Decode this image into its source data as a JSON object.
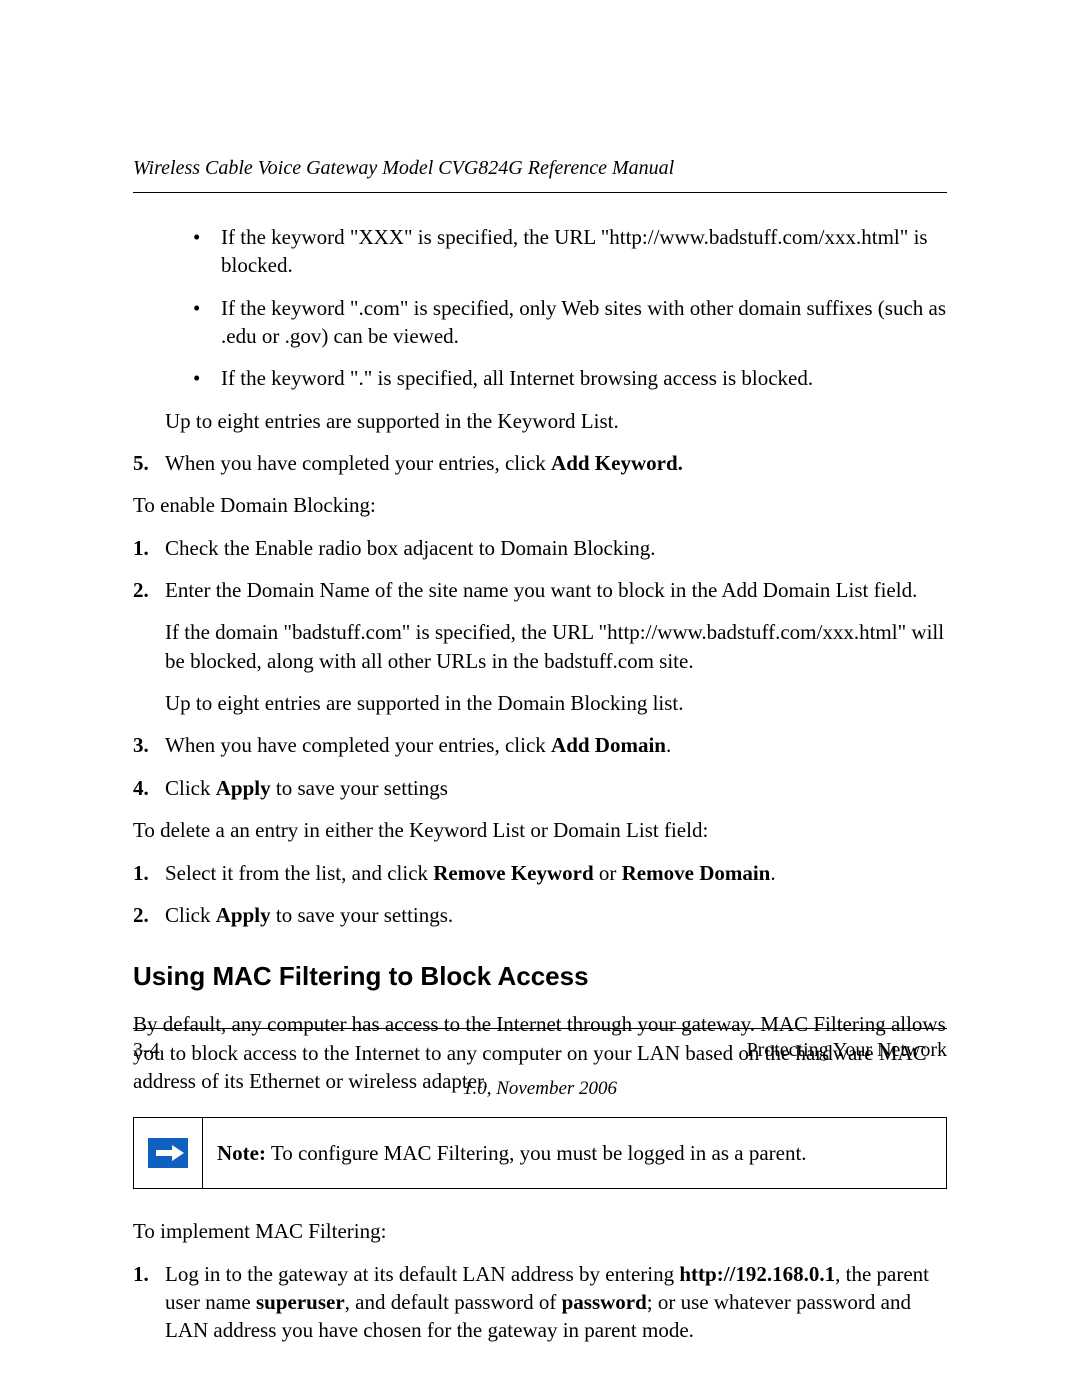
{
  "header": {
    "running_title": "Wireless Cable Voice Gateway Model CVG824G Reference Manual"
  },
  "bullets": {
    "b1a": "If the keyword \"XXX\" is specified, the URL \"http://www.badstuff.com/xxx.html\" is blocked.",
    "b1b": "If the keyword \".com\" is specified, only Web sites with other domain suffixes (such as .edu or .gov) can be viewed.",
    "b1c": "If the keyword \".\" is specified, all Internet browsing access is blocked.",
    "after": "Up to eight entries are supported in the Keyword List."
  },
  "step5": {
    "num": "5.",
    "pre": "When you have completed your entries, click ",
    "bold": "Add Keyword."
  },
  "domain_intro": "To enable Domain Blocking:",
  "d1": {
    "num": "1.",
    "text": "Check the Enable radio box adjacent to Domain Blocking."
  },
  "d2": {
    "num": "2.",
    "text": "Enter the Domain Name of the site name you want to block in the Add Domain List field.",
    "sub1": "If the domain \"badstuff.com\" is specified, the URL \"http://www.badstuff.com/xxx.html\" will be blocked, along with all other URLs in the badstuff.com site.",
    "sub2": "Up to eight entries are supported in the Domain Blocking list."
  },
  "d3": {
    "num": "3.",
    "pre": "When you have completed your entries, click ",
    "bold": "Add Domain",
    "post": "."
  },
  "d4": {
    "num": "4.",
    "pre": "Click ",
    "bold": "Apply",
    "post": " to save your settings"
  },
  "delete_intro": "To delete a an entry in either the Keyword List or Domain List field:",
  "del1": {
    "num": "1.",
    "pre": "Select it from the list, and click ",
    "bold1": "Remove Keyword",
    "mid": " or ",
    "bold2": "Remove Domain",
    "post": "."
  },
  "del2": {
    "num": "2.",
    "pre": "Click ",
    "bold": "Apply",
    "post": " to save your settings."
  },
  "section_heading": "Using MAC Filtering to Block Access",
  "mac_intro": "By default, any computer has access to the Internet through your gateway. MAC Filtering allows you to block access to the Internet to any computer on your LAN based on the hardware MAC address of its Ethernet or wireless adapter.",
  "note": {
    "label": "Note:",
    "text": " To configure MAC Filtering, you must be logged in as a parent."
  },
  "impl_intro": "To implement MAC Filtering:",
  "impl1": {
    "num": "1.",
    "t1": "Log in to the gateway at its default LAN address by entering ",
    "b1": "http://192.168.0.1",
    "t2": ", the parent user name ",
    "b2": "superuser",
    "t3": ", and default password of ",
    "b3": "password",
    "t4": "; or use whatever password and LAN address you have chosen for the gateway in parent mode."
  },
  "footer": {
    "page": "3-4",
    "chapter": "Protecting Your Network",
    "version": "1.0, November 2006"
  }
}
